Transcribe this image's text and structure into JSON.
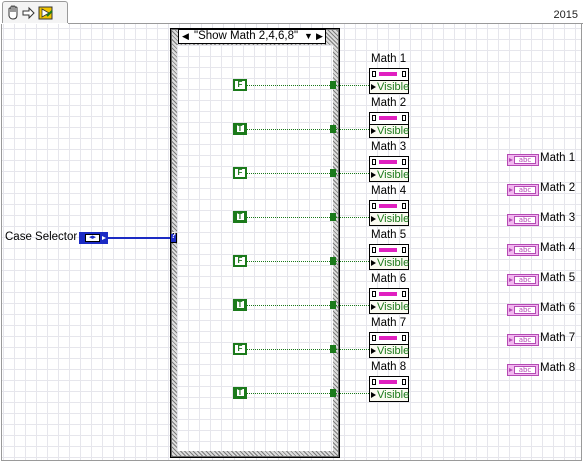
{
  "toolbar": {
    "version_year": "2015"
  },
  "case_structure": {
    "selector_value": "\"Show Math 2,4,6,8\""
  },
  "case_selector": {
    "label": "Case Selector"
  },
  "constants": [
    "F",
    "T",
    "F",
    "T",
    "F",
    "T",
    "F",
    "T"
  ],
  "property_nodes": [
    {
      "label": "Math 1",
      "property": "Visible"
    },
    {
      "label": "Math 2",
      "property": "Visible"
    },
    {
      "label": "Math 3",
      "property": "Visible"
    },
    {
      "label": "Math 4",
      "property": "Visible"
    },
    {
      "label": "Math 5",
      "property": "Visible"
    },
    {
      "label": "Math 6",
      "property": "Visible"
    },
    {
      "label": "Math 7",
      "property": "Visible"
    },
    {
      "label": "Math 8",
      "property": "Visible"
    }
  ],
  "string_indicators": [
    {
      "label": "Math 1"
    },
    {
      "label": "Math 2"
    },
    {
      "label": "Math 3"
    },
    {
      "label": "Math 4"
    },
    {
      "label": "Math 5"
    },
    {
      "label": "Math 6"
    },
    {
      "label": "Math 7"
    },
    {
      "label": "Math 8"
    }
  ],
  "colors": {
    "boolean": "#1b7a1b",
    "enum": "#1c2bc4",
    "string": "#e020c0",
    "case_frame": "#6a6a6a"
  }
}
